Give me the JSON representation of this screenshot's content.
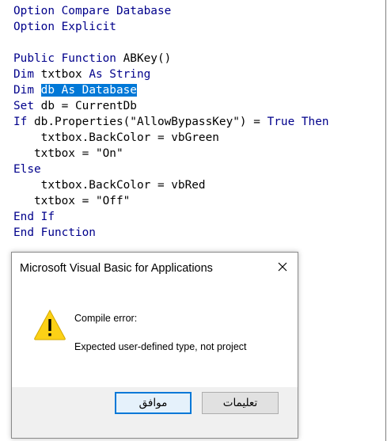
{
  "code": {
    "lines": [
      [
        {
          "t": "Option Compare Database",
          "c": "kw"
        }
      ],
      [
        {
          "t": "Option Explicit",
          "c": "kw"
        }
      ],
      [
        {
          "t": "",
          "c": ""
        }
      ],
      [
        {
          "t": "Public Function",
          "c": "kw"
        },
        {
          "t": " ABKey()",
          "c": ""
        }
      ],
      [
        {
          "t": "Dim",
          "c": "kw"
        },
        {
          "t": " txtbox ",
          "c": ""
        },
        {
          "t": "As String",
          "c": "kw"
        }
      ],
      [
        {
          "t": "Dim",
          "c": "kw"
        },
        {
          "t": " ",
          "c": ""
        },
        {
          "t": "db As Database",
          "c": "sel"
        }
      ],
      [
        {
          "t": "Set",
          "c": "kw"
        },
        {
          "t": " db = CurrentDb",
          "c": ""
        }
      ],
      [
        {
          "t": "If",
          "c": "kw"
        },
        {
          "t": " db.Properties(\"AllowBypassKey\") = ",
          "c": ""
        },
        {
          "t": "True Then",
          "c": "kw"
        }
      ],
      [
        {
          "t": "    txtbox.BackColor = vbGreen",
          "c": ""
        }
      ],
      [
        {
          "t": "   txtbox = \"On\"",
          "c": ""
        }
      ],
      [
        {
          "t": "Else",
          "c": "kw"
        }
      ],
      [
        {
          "t": "    txtbox.BackColor = vbRed",
          "c": ""
        }
      ],
      [
        {
          "t": "   txtbox = \"Off\"",
          "c": ""
        }
      ],
      [
        {
          "t": "End If",
          "c": "kw"
        }
      ],
      [
        {
          "t": "End Function",
          "c": "kw"
        }
      ]
    ]
  },
  "dialog": {
    "title": "Microsoft Visual Basic for Applications",
    "icon": "warning-icon",
    "message_title": "Compile error:",
    "message_body": "Expected user-defined type, not project",
    "ok_label": "موافق",
    "help_label": "تعليمات"
  },
  "colors": {
    "keyword": "#00008b",
    "selection": "#0078d7",
    "warning_fill": "#fcd116",
    "default_button_border": "#0078d7"
  }
}
